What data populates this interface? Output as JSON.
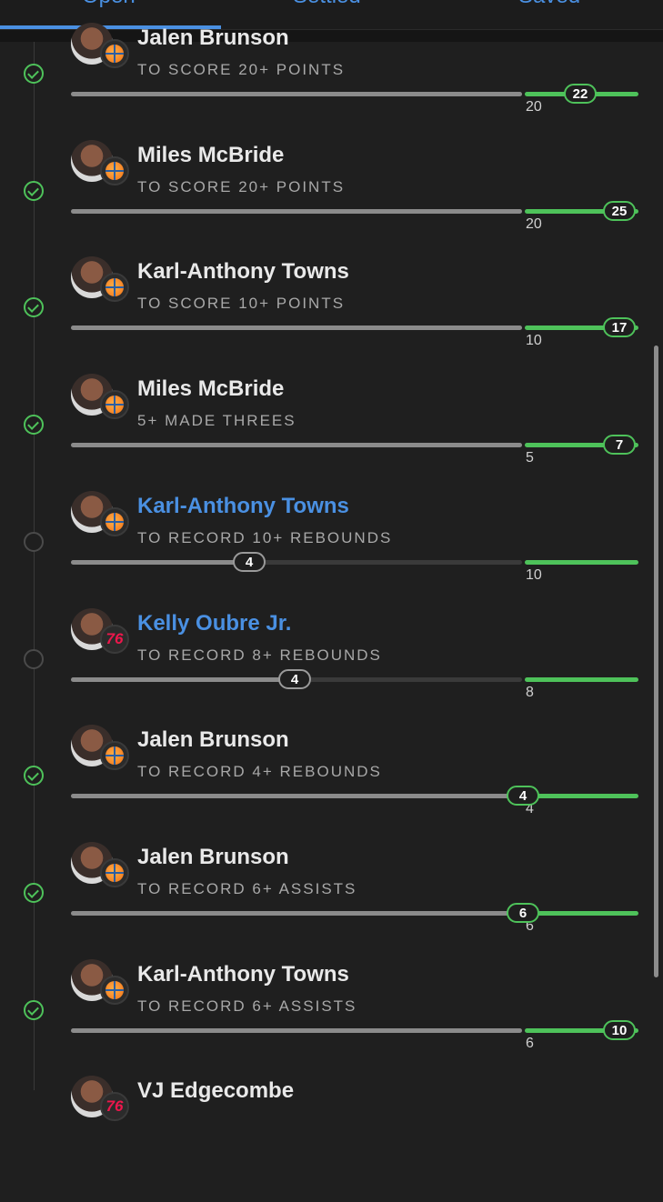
{
  "tabs": [
    {
      "label": "Open"
    },
    {
      "label": "Settled"
    },
    {
      "label": "Saved"
    }
  ],
  "rows": [
    {
      "name": "Jalen Brunson",
      "prop": "TO SCORE 20+ POINTS",
      "threshold": "20",
      "value": "22",
      "progress": 1.0,
      "status": "done",
      "team": "knicks-icon",
      "active": false
    },
    {
      "name": "Miles McBride",
      "prop": "TO SCORE 20+ POINTS",
      "threshold": "20",
      "value": "25",
      "progress": 1.0,
      "status": "done",
      "team": "knicks-icon",
      "active": false
    },
    {
      "name": "Karl-Anthony Towns",
      "prop": "TO SCORE 10+ POINTS",
      "threshold": "10",
      "value": "17",
      "progress": 1.0,
      "status": "done",
      "team": "knicks-icon",
      "active": false
    },
    {
      "name": "Miles McBride",
      "prop": "5+ MADE THREES",
      "threshold": "5",
      "value": "7",
      "progress": 1.0,
      "status": "done",
      "team": "knicks-icon",
      "active": false
    },
    {
      "name": "Karl-Anthony Towns",
      "prop": "TO RECORD 10+ REBOUNDS",
      "threshold": "10",
      "value": "4",
      "progress": 0.4,
      "status": "open",
      "team": "knicks-icon",
      "active": true
    },
    {
      "name": "Kelly Oubre Jr.",
      "prop": "TO RECORD 8+ REBOUNDS",
      "threshold": "8",
      "value": "4",
      "progress": 0.5,
      "status": "open",
      "team": "76ers-icon",
      "active": true
    },
    {
      "name": "Jalen Brunson",
      "prop": "TO RECORD 4+ REBOUNDS",
      "threshold": "4",
      "value": "4",
      "progress": 1.0,
      "status": "done",
      "team": "knicks-icon",
      "active": false
    },
    {
      "name": "Jalen Brunson",
      "prop": "TO RECORD 6+ ASSISTS",
      "threshold": "6",
      "value": "6",
      "progress": 1.0,
      "status": "done",
      "team": "knicks-icon",
      "active": false
    },
    {
      "name": "Karl-Anthony Towns",
      "prop": "TO RECORD 6+ ASSISTS",
      "threshold": "6",
      "value": "10",
      "progress": 1.0,
      "status": "done",
      "team": "knicks-icon",
      "active": false
    },
    {
      "name": "VJ Edgecombe",
      "prop": "",
      "threshold": "",
      "value": "",
      "progress": 0,
      "status": "",
      "team": "76ers-icon",
      "active": false
    }
  ],
  "sixers_logo_text": "76",
  "colors": {
    "accent": "#4a90e2",
    "success": "#4ec25a",
    "background": "#1f1f1f"
  }
}
